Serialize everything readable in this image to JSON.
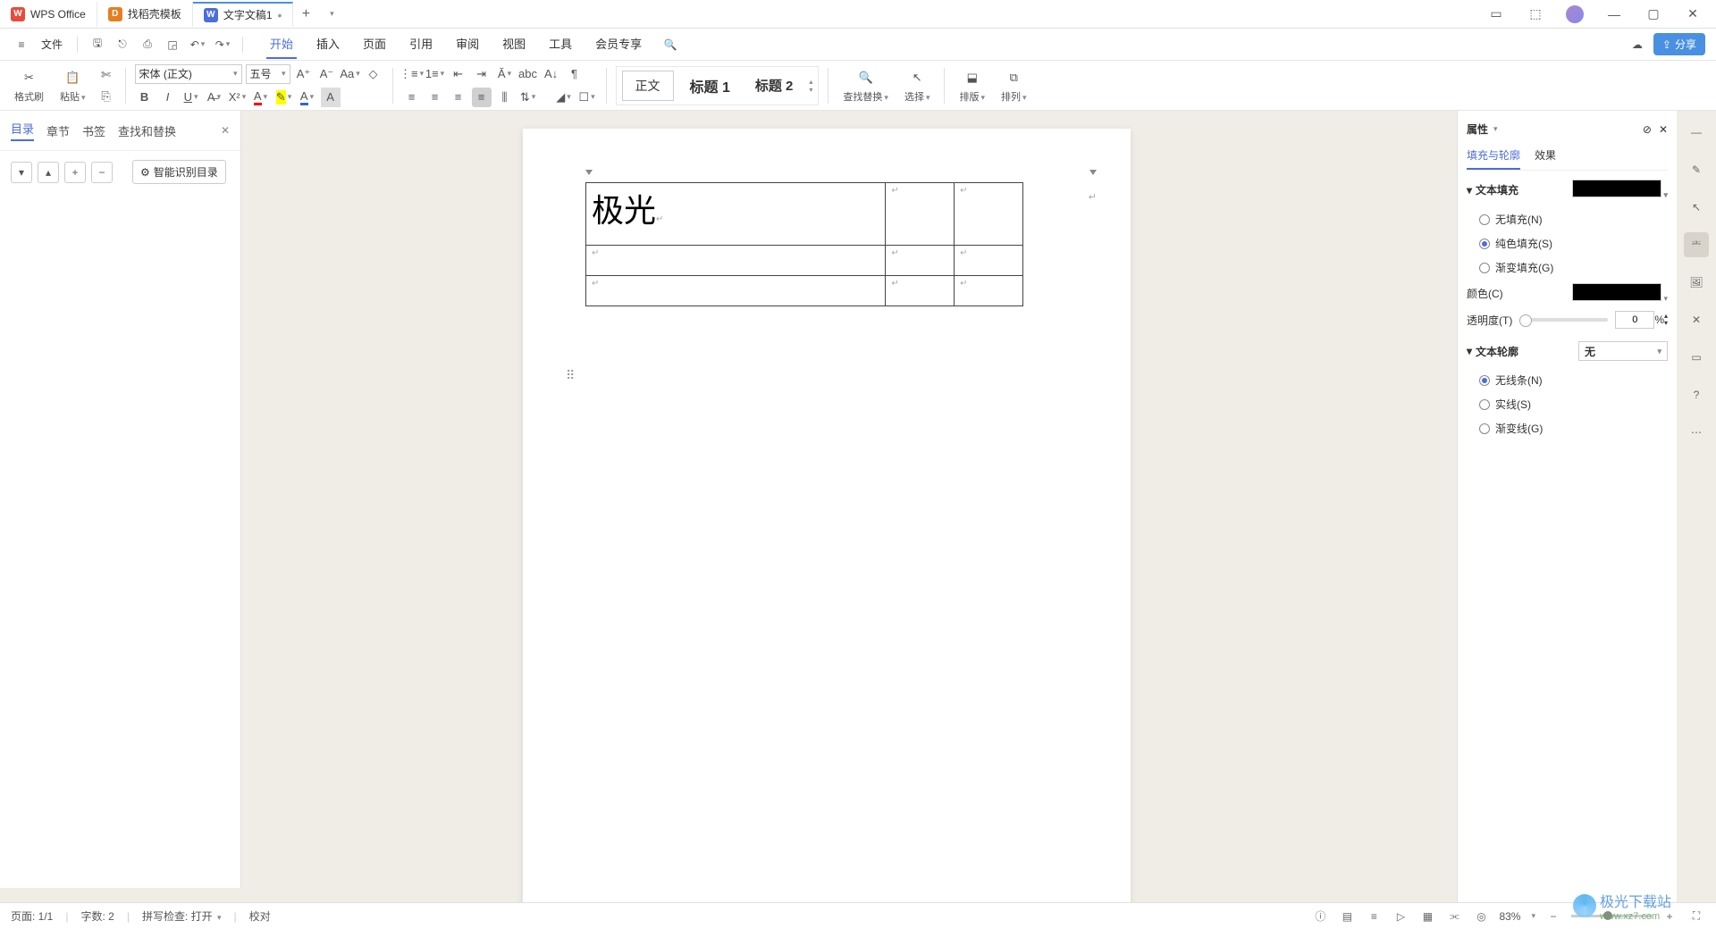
{
  "titlebar": {
    "tabs": [
      {
        "label": "WPS Office"
      },
      {
        "label": "找稻壳模板"
      },
      {
        "label": "文字文稿1"
      }
    ],
    "newtab_icon": "plus-icon"
  },
  "menubar": {
    "file_label": "文件",
    "tabs": [
      "开始",
      "插入",
      "页面",
      "引用",
      "审阅",
      "视图",
      "工具",
      "会员专享"
    ],
    "active_tab": "开始",
    "share_label": "分享"
  },
  "ribbon": {
    "format_brush": "格式刷",
    "paste": "粘贴",
    "font_name": "宋体 (正文)",
    "font_size": "五号",
    "styles": {
      "normal": "正文",
      "h1": "标题 1",
      "h2": "标题 2"
    },
    "find_replace": "查找替换",
    "select": "选择",
    "layout": "排版",
    "arrange": "排列"
  },
  "sidenav": {
    "tabs": [
      "目录",
      "章节",
      "书签",
      "查找和替换"
    ],
    "active": "目录",
    "smart_toc": "智能识别目录"
  },
  "document": {
    "cell_text": "极光"
  },
  "properties": {
    "title": "属性",
    "tabs": {
      "fill_outline": "填充与轮廓",
      "effect": "效果"
    },
    "active_tab": "填充_outline",
    "text_fill": {
      "title": "文本填充",
      "none": "无填充(N)",
      "solid": "纯色填充(S)",
      "gradient": "渐变填充(G)",
      "color_label": "颜色(C)",
      "opacity_label": "透明度(T)",
      "opacity_value": "0",
      "opacity_unit": "%"
    },
    "text_outline": {
      "title": "文本轮廓",
      "select_value": "无",
      "none": "无线条(N)",
      "solid": "实线(S)",
      "gradient": "渐变线(G)"
    }
  },
  "statusbar": {
    "page": "页面: 1/1",
    "words": "字数: 2",
    "spell": "拼写检查: 打开",
    "proof": "校对",
    "zoom": "83%"
  },
  "watermark": {
    "main": "极光下载站",
    "sub": "www.xz7.com"
  }
}
